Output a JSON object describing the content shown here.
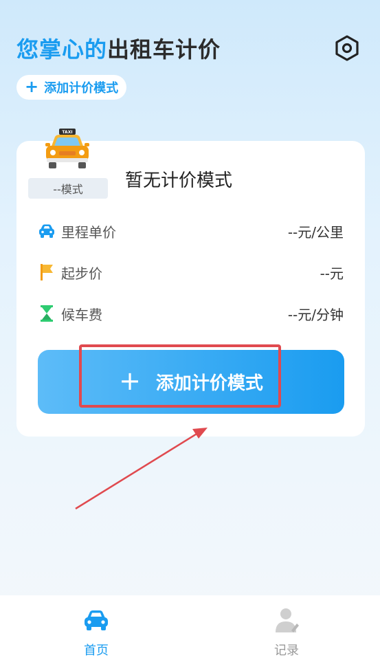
{
  "header": {
    "title_accent": "您掌心的",
    "title_main": "出租车计价",
    "settings_icon": "settings-icon"
  },
  "add_chip": {
    "plus": "+",
    "label": "添加计价模式"
  },
  "card": {
    "taxi_sign": "TAXI",
    "mode_badge": "--模式",
    "no_mode": "暂无计价模式",
    "rows": [
      {
        "icon": "car-icon",
        "label": "里程单价",
        "value": "--元/公里"
      },
      {
        "icon": "flag-icon",
        "label": "起步价",
        "value": "--元"
      },
      {
        "icon": "hourglass-icon",
        "label": "候车费",
        "value": "--元/分钟"
      }
    ],
    "add_button": {
      "plus": "+",
      "label": "添加计价模式"
    }
  },
  "tabs": [
    {
      "label": "首页",
      "icon": "car-icon",
      "active": true
    },
    {
      "label": "记录",
      "icon": "user-icon",
      "active": false
    }
  ],
  "colors": {
    "accent": "#1a9cf0",
    "highlight": "#e04a4f",
    "inactive": "#999999"
  }
}
